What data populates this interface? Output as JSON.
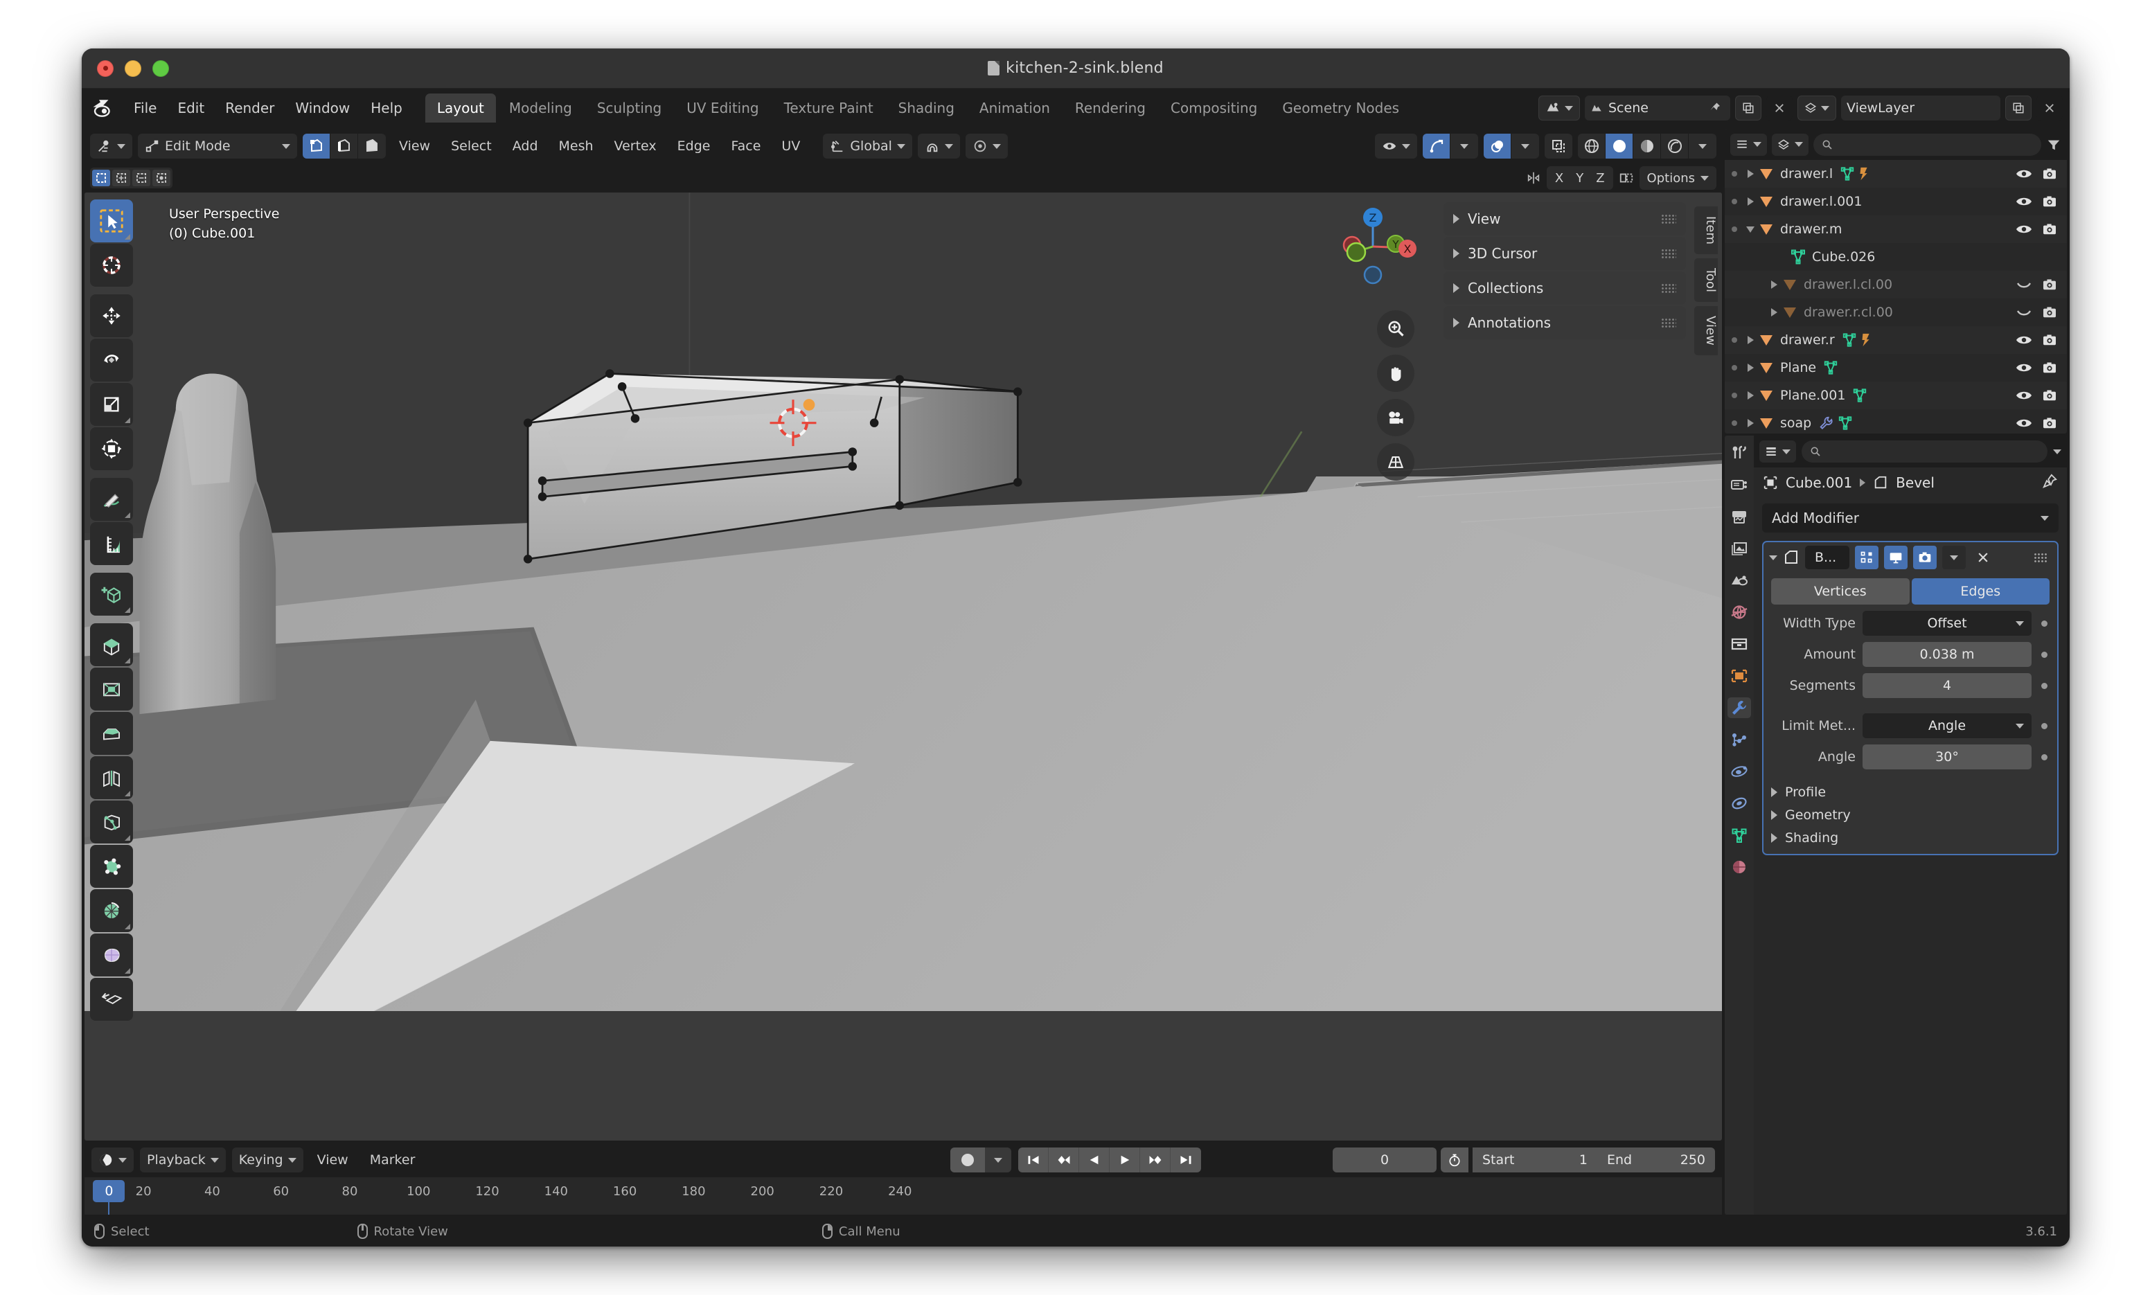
{
  "window": {
    "title": "kitchen-2-sink.blend",
    "version": "3.6.1"
  },
  "topbar": {
    "menus": [
      "File",
      "Edit",
      "Render",
      "Window",
      "Help"
    ],
    "workspaces": [
      {
        "label": "Layout",
        "active": true
      },
      {
        "label": "Modeling",
        "active": false
      },
      {
        "label": "Sculpting",
        "active": false
      },
      {
        "label": "UV Editing",
        "active": false
      },
      {
        "label": "Texture Paint",
        "active": false
      },
      {
        "label": "Shading",
        "active": false
      },
      {
        "label": "Animation",
        "active": false
      },
      {
        "label": "Rendering",
        "active": false
      },
      {
        "label": "Compositing",
        "active": false
      },
      {
        "label": "Geometry Nodes",
        "active": false
      }
    ],
    "scene_name": "Scene",
    "viewlayer_name": "ViewLayer"
  },
  "viewport_header": {
    "mode": "Edit Mode",
    "menus": [
      "View",
      "Select",
      "Add",
      "Mesh",
      "Vertex",
      "Edge",
      "Face",
      "UV"
    ],
    "transform_orientation": "Global",
    "select_modes": [
      {
        "name": "vertex-select",
        "active": true
      },
      {
        "name": "edge-select",
        "active": false
      },
      {
        "name": "face-select",
        "active": false
      }
    ],
    "shading_modes": [
      {
        "name": "wireframe",
        "active": false
      },
      {
        "name": "solid",
        "active": true
      },
      {
        "name": "material-preview",
        "active": false
      },
      {
        "name": "rendered",
        "active": false
      }
    ],
    "axis_labels": [
      "X",
      "Y",
      "Z"
    ],
    "options_label": "Options"
  },
  "viewport": {
    "perspective_label": "User Perspective",
    "object_label": "(0) Cube.001",
    "gizmo_axes": [
      "X",
      "Y",
      "Z"
    ],
    "tools": [
      {
        "name": "tweak-tool",
        "active": true
      },
      {
        "name": "cursor-tool",
        "active": false
      },
      {
        "name": "move-tool",
        "active": false
      },
      {
        "name": "rotate-tool",
        "active": false
      },
      {
        "name": "scale-tool",
        "active": false
      },
      {
        "name": "transform-tool",
        "active": false
      },
      {
        "name": "annotate-tool",
        "active": false
      },
      {
        "name": "measure-tool",
        "active": false
      },
      {
        "name": "add-cube-tool",
        "active": false
      },
      {
        "name": "extrude-region-tool",
        "active": false
      },
      {
        "name": "inset-faces-tool",
        "active": false
      },
      {
        "name": "bevel-tool",
        "active": false
      },
      {
        "name": "loop-cut-tool",
        "active": false
      },
      {
        "name": "knife-tool",
        "active": false
      },
      {
        "name": "poly-build-tool",
        "active": false
      },
      {
        "name": "spin-tool",
        "active": false
      },
      {
        "name": "smooth-tool",
        "active": false
      },
      {
        "name": "shrink-fatten-tool",
        "active": false
      }
    ],
    "nav_buttons": [
      "zoom-icon",
      "pan-icon",
      "camera-icon",
      "perspective-icon"
    ]
  },
  "sidebar": {
    "panels": [
      "View",
      "3D Cursor",
      "Collections",
      "Annotations"
    ],
    "tabs": [
      "Item",
      "Tool",
      "View"
    ]
  },
  "outliner": {
    "rows": [
      {
        "name": "drawer.l",
        "indent": 0,
        "expand": "collapsed",
        "type": "object",
        "icons": [
          "mesh-data-icon",
          "modifier-icon"
        ],
        "visible": true,
        "render": true
      },
      {
        "name": "drawer.l.001",
        "indent": 0,
        "expand": "collapsed",
        "type": "object",
        "icons": [],
        "visible": true,
        "render": true
      },
      {
        "name": "drawer.m",
        "indent": 0,
        "expand": "expanded",
        "type": "object",
        "icons": [],
        "visible": true,
        "render": true
      },
      {
        "name": "Cube.026",
        "indent": 2,
        "expand": "none",
        "type": "mesh",
        "icons": [],
        "visible": null,
        "render": null
      },
      {
        "name": "drawer.l.cl.00",
        "indent": 1,
        "expand": "collapsed",
        "type": "object-dim",
        "icons": [],
        "visible": false,
        "render": true
      },
      {
        "name": "drawer.r.cl.00",
        "indent": 1,
        "expand": "collapsed",
        "type": "object-dim",
        "icons": [],
        "visible": false,
        "render": true
      },
      {
        "name": "drawer.r",
        "indent": 0,
        "expand": "collapsed",
        "type": "object",
        "icons": [
          "mesh-data-icon",
          "modifier-icon"
        ],
        "visible": true,
        "render": true
      },
      {
        "name": "Plane",
        "indent": 0,
        "expand": "collapsed",
        "type": "object",
        "icons": [
          "mesh-data-icon"
        ],
        "visible": true,
        "render": true
      },
      {
        "name": "Plane.001",
        "indent": 0,
        "expand": "collapsed",
        "type": "object",
        "icons": [
          "mesh-data-icon"
        ],
        "visible": true,
        "render": true
      },
      {
        "name": "soap",
        "indent": 0,
        "expand": "collapsed",
        "type": "object",
        "icons": [
          "wrench-icon",
          "mesh-data-icon"
        ],
        "visible": true,
        "render": true
      }
    ]
  },
  "properties": {
    "breadcrumb_object": "Cube.001",
    "breadcrumb_modifier": "Bevel",
    "add_modifier_label": "Add Modifier",
    "modifier": {
      "name_abbrev": "B...",
      "display_toggles": [
        {
          "name": "edit-mode-display-toggle",
          "active": true
        },
        {
          "name": "realtime-display-toggle",
          "active": true
        },
        {
          "name": "render-display-toggle",
          "active": true
        }
      ],
      "affect_options": [
        {
          "label": "Vertices",
          "active": false
        },
        {
          "label": "Edges",
          "active": true
        }
      ],
      "fields": [
        {
          "label": "Width Type",
          "value": "Offset",
          "kind": "dropdown"
        },
        {
          "label": "Amount",
          "value": "0.038 m",
          "kind": "number"
        },
        {
          "label": "Segments",
          "value": "4",
          "kind": "number"
        }
      ],
      "fields2": [
        {
          "label": "Limit Met...",
          "value": "Angle",
          "kind": "dropdown"
        },
        {
          "label": "Angle",
          "value": "30°",
          "kind": "number"
        }
      ],
      "subpanels": [
        "Profile",
        "Geometry",
        "Shading"
      ]
    },
    "tabs": [
      {
        "name": "tool-tab",
        "active": false
      },
      {
        "name": "render-tab",
        "active": false
      },
      {
        "name": "output-tab",
        "active": false
      },
      {
        "name": "viewlayer-tab",
        "active": false
      },
      {
        "name": "scene-tab",
        "active": false
      },
      {
        "name": "world-tab",
        "active": false
      },
      {
        "name": "collection-tab",
        "active": false
      },
      {
        "name": "object-tab",
        "active": false
      },
      {
        "name": "modifier-tab",
        "active": true
      },
      {
        "name": "particles-tab",
        "active": false
      },
      {
        "name": "physics-tab",
        "active": false
      },
      {
        "name": "constraints-tab",
        "active": false
      },
      {
        "name": "data-tab",
        "active": false
      },
      {
        "name": "material-tab",
        "active": false
      }
    ]
  },
  "timeline": {
    "menus": [
      "Playback",
      "Keying",
      "View",
      "Marker"
    ],
    "ticks": [
      "0",
      "20",
      "40",
      "60",
      "80",
      "100",
      "120",
      "140",
      "160",
      "180",
      "200",
      "220",
      "240"
    ],
    "current_frame": "0",
    "start_label": "Start",
    "start_value": "1",
    "end_label": "End",
    "end_value": "250",
    "transport": [
      "jump-start-icon",
      "prev-keyframe-icon",
      "play-reverse-icon",
      "play-icon",
      "next-keyframe-icon",
      "jump-end-icon"
    ]
  },
  "statusbar": {
    "hints": [
      {
        "mouse": "left",
        "label": "Select"
      },
      {
        "mouse": "middle",
        "label": "Rotate View"
      },
      {
        "mouse": "right",
        "label": "Call Menu"
      }
    ]
  },
  "colors": {
    "accent_blue": "#4772b3",
    "panel_bg": "#282828",
    "header_bg": "#1d1d1d",
    "object_orange": "#ed9e5c",
    "mesh_green": "#2fd19b"
  }
}
